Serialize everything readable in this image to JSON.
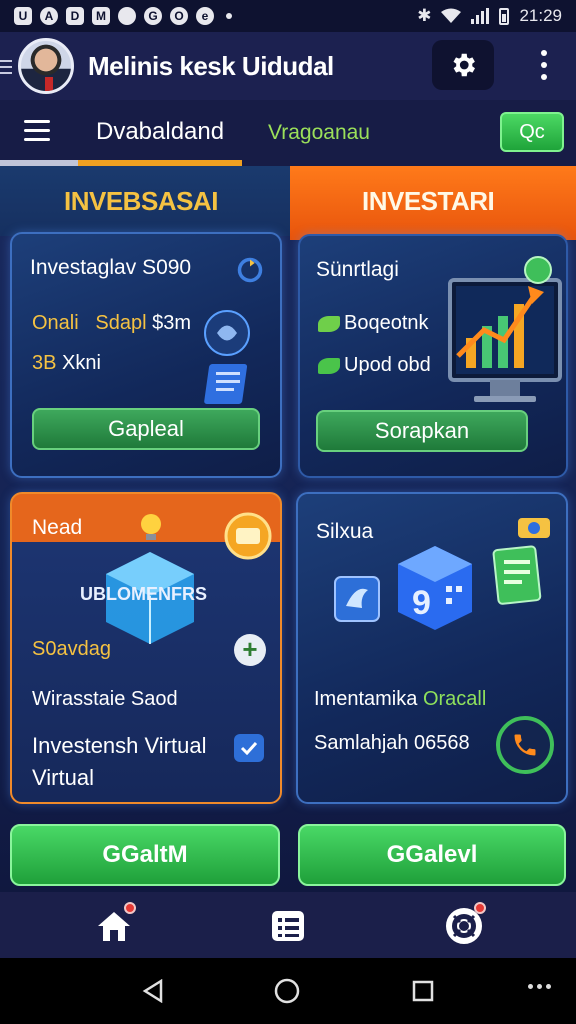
{
  "status_bar": {
    "time": "21:29",
    "notification_icons": [
      "U",
      "A",
      "D",
      "M",
      "",
      "G",
      "O",
      "e"
    ]
  },
  "header": {
    "title": "Melinis kesk Uidudal"
  },
  "tabs": {
    "active": "Dvabaldand",
    "secondary": "Vragoanau",
    "search_label": "Qc"
  },
  "segments": {
    "left": "INVEBSASAI",
    "right": "INVESTARI"
  },
  "card1": {
    "title": "Investaglav S090",
    "line2_a": "Onali",
    "line2_b": "Sdapl",
    "line2_c": "$3m",
    "line3_a": "3B",
    "line3_b": "Xkni",
    "button": "Gapleal"
  },
  "card2": {
    "title": "Sünrtlagi",
    "line2": "Boqeotnk",
    "line3": "Upod obd",
    "button": "Sorapkan"
  },
  "card3": {
    "head": "Nead",
    "cube_label": "UBLOMENFRS",
    "line3": "S0avdag",
    "line4": "Wirasstaie Saod",
    "line5": "Investensh Virtual Virtual"
  },
  "card4": {
    "title": "Silxua",
    "line2_a": "Imentamika",
    "line2_b": "Oracall",
    "line3": "Samlahjah 06568"
  },
  "actions": {
    "primary": "GGaltM",
    "secondary": "GGalevl"
  },
  "colors": {
    "accent_orange": "#ff7a1a",
    "accent_green": "#3fbf5a",
    "gold": "#f5c242",
    "background": "#141a3d"
  }
}
